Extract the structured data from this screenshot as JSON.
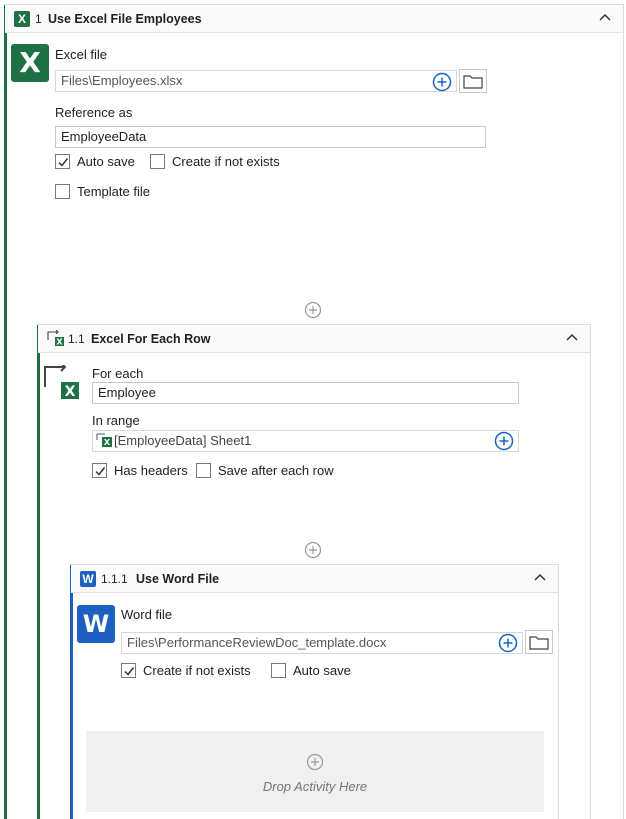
{
  "activity1": {
    "number": "1",
    "title": "Use Excel File Employees",
    "icon": "excel-icon",
    "excel_file_label": "Excel file",
    "excel_file_value": "Files\\Employees.xlsx",
    "reference_label": "Reference as",
    "reference_value": "EmployeeData",
    "auto_save_label": "Auto save",
    "auto_save_checked": true,
    "create_label": "Create if not exists",
    "create_checked": false,
    "template_label": "Template file",
    "template_checked": false
  },
  "activity11": {
    "number": "1.1",
    "title": "Excel For Each Row",
    "icon": "excel-for-each-icon",
    "for_each_label": "For each",
    "for_each_value": "Employee",
    "in_range_label": "In range",
    "in_range_value": "[EmployeeData] Sheet1",
    "has_headers_label": "Has headers",
    "has_headers_checked": true,
    "save_after_label": "Save after each row",
    "save_after_checked": false
  },
  "activity111": {
    "number": "1.1.1",
    "title": "Use Word File",
    "icon": "word-icon",
    "word_file_label": "Word file",
    "word_file_value": "Files\\PerformanceReviewDoc_template.docx",
    "create_label": "Create if not exists",
    "create_checked": true,
    "auto_save_label": "Auto save",
    "auto_save_checked": false,
    "drop_text": "Drop Activity Here"
  },
  "colors": {
    "excel_green": "#1e7145",
    "word_blue": "#1e5fbf",
    "accent_blue": "#1565c0"
  }
}
